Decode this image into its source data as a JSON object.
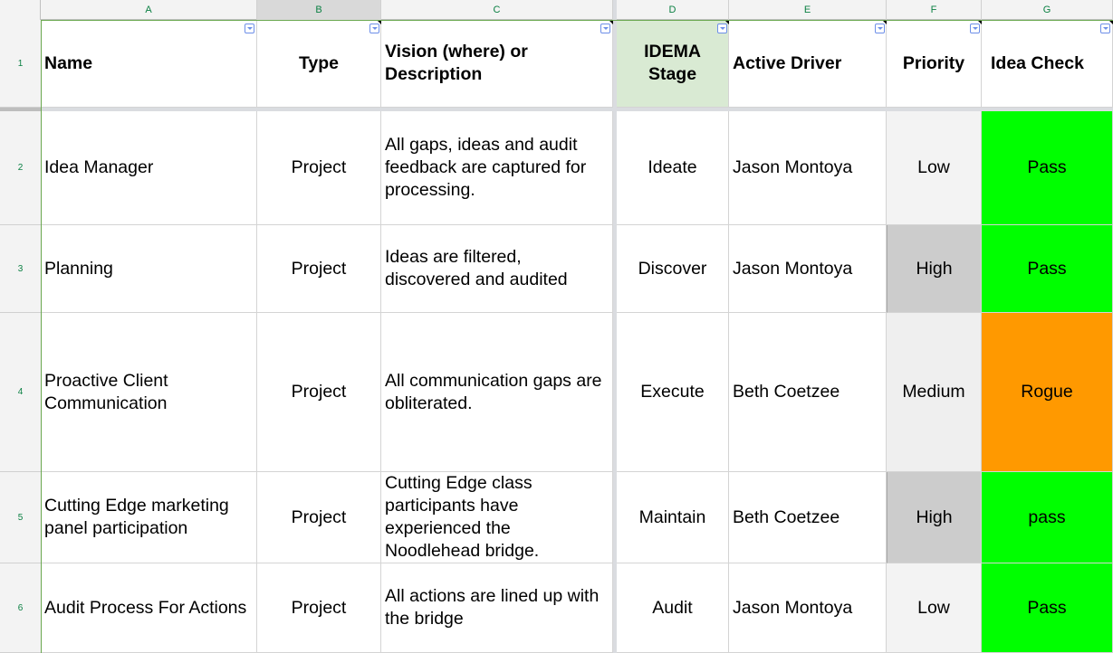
{
  "sheet": {
    "column_letters": [
      "A",
      "B",
      "C",
      "D",
      "E",
      "F",
      "G"
    ],
    "row_numbers": [
      "1",
      "2",
      "3",
      "4",
      "5",
      "6"
    ],
    "headers": {
      "name": "Name",
      "type": "Type",
      "description": "Vision (where) or Description",
      "stage": "IDEMA Stage",
      "driver": "Active Driver",
      "priority": "Priority",
      "idea_check": "Idea Check"
    },
    "rows": [
      {
        "name": "Idea Manager",
        "type": "Project",
        "description": "All gaps, ideas and audit feedback are captured for processing.",
        "stage": "Ideate",
        "driver": "Jason Montoya",
        "priority": "Low",
        "idea_check": "Pass"
      },
      {
        "name": "Planning",
        "type": "Project",
        "description": "Ideas are filtered, discovered and audited",
        "stage": "Discover",
        "driver": "Jason Montoya",
        "priority": "High",
        "idea_check": "Pass"
      },
      {
        "name": "Proactive Client Communication",
        "type": "Project",
        "description": "All communication gaps are obliterated.",
        "stage": "Execute",
        "driver": "Beth Coetzee",
        "priority": "Medium",
        "idea_check": "Rogue"
      },
      {
        "name": "Cutting Edge marketing panel participation",
        "type": "Project",
        "description": "Cutting Edge class participants have experienced the Noodlehead bridge.",
        "stage": "Maintain",
        "driver": "Beth Coetzee",
        "priority": "High",
        "idea_check": "pass"
      },
      {
        "name": "Audit Process For Actions",
        "type": "Project",
        "description": "All actions are lined up with the bridge",
        "stage": "Audit",
        "driver": "Jason Montoya",
        "priority": "Low",
        "idea_check": "Pass"
      }
    ],
    "colors": {
      "stage_header_fill": "#d9ead3",
      "priority_low_fill": "#f3f3f3",
      "priority_medium_fill": "#efefef",
      "priority_high_fill": "#cccccc",
      "check_pass_fill": "#00ff00",
      "check_rogue_fill": "#ff9900",
      "accent_green": "#0b8043",
      "selection_border": "#6aa84f"
    },
    "icons": {
      "filter": "filter-dropdown-icon"
    }
  }
}
